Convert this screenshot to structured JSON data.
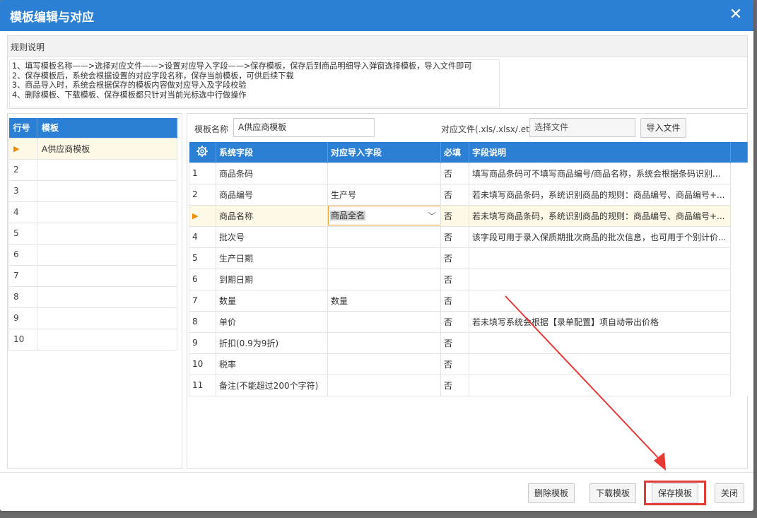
{
  "dialog": {
    "title": "模板编辑与对应",
    "close_glyph": "✕"
  },
  "rules": {
    "header": "规则说明",
    "lines": [
      "1、填写模板名称——>选择对应文件——>设置对应导入字段——>保存模板，保存后到商品明细导入弹窗选择模板，导入文件即可",
      "2、保存模板后，系统会根据设置的对应字段名称，保存当前模板，可供后续下载",
      "3、商品导入时，系统会根据保存的模板内容做对应导入及字段校验",
      "4、删除模板、下载模板、保存模板都只针对当前光标选中行做操作"
    ]
  },
  "templates": {
    "headers": [
      "行号",
      "模板"
    ],
    "rows": [
      {
        "num": "",
        "name": "A供应商模板",
        "selected": true
      },
      {
        "num": "2",
        "name": ""
      },
      {
        "num": "3",
        "name": ""
      },
      {
        "num": "4",
        "name": ""
      },
      {
        "num": "5",
        "name": ""
      },
      {
        "num": "6",
        "name": ""
      },
      {
        "num": "7",
        "name": ""
      },
      {
        "num": "8",
        "name": ""
      },
      {
        "num": "9",
        "name": ""
      },
      {
        "num": "10",
        "name": ""
      }
    ]
  },
  "form": {
    "name_label": "模板名称",
    "name_value": "A供应商模板",
    "file_label": "对应文件(.xls/.xlsx/.et)",
    "file_placeholder": "选择文件",
    "import_button": "导入文件"
  },
  "fields": {
    "headers": [
      "系统字段",
      "对应导入字段",
      "必填",
      "字段说明"
    ],
    "rows": [
      {
        "num": "1",
        "field": "商品条码",
        "mapped": "",
        "required": "否",
        "desc": "填写商品条码可不填写商品编号/商品名称，系统会根据条码识别..."
      },
      {
        "num": "2",
        "field": "商品编号",
        "mapped": "生产号",
        "required": "否",
        "desc": "若未填写商品条码，系统识别商品的规则：商品编号、商品编号+..."
      },
      {
        "num": "",
        "field": "商品名称",
        "mapped": "商品全名",
        "required": "否",
        "desc": "若未填写商品条码，系统识别商品的规则：商品编号、商品编号+...",
        "selected": true
      },
      {
        "num": "4",
        "field": "批次号",
        "mapped": "",
        "required": "否",
        "desc": "该字段可用于录入保质期批次商品的批次信息，也可用于个别计价..."
      },
      {
        "num": "5",
        "field": "生产日期",
        "mapped": "",
        "required": "否",
        "desc": ""
      },
      {
        "num": "6",
        "field": "到期日期",
        "mapped": "",
        "required": "否",
        "desc": ""
      },
      {
        "num": "7",
        "field": "数量",
        "mapped": "数量",
        "required": "否",
        "desc": ""
      },
      {
        "num": "8",
        "field": "单价",
        "mapped": "",
        "required": "否",
        "desc": "若未填写系统会根据【录单配置】项自动带出价格"
      },
      {
        "num": "9",
        "field": "折扣(0.9为9折)",
        "mapped": "",
        "required": "否",
        "desc": ""
      },
      {
        "num": "10",
        "field": "税率",
        "mapped": "",
        "required": "否",
        "desc": ""
      },
      {
        "num": "11",
        "field": "备注(不能超过200个字符)",
        "mapped": "",
        "required": "否",
        "desc": ""
      }
    ]
  },
  "footer": {
    "delete": "删除模板",
    "download": "下载模板",
    "save": "保存模板",
    "close": "关闭"
  },
  "icons": {
    "row_pointer": "▶",
    "settings": "gear-icon",
    "dropdown": "chevron-down-icon"
  },
  "colors": {
    "primary": "#2b7fd4",
    "selected_row": "#fdf9e6",
    "annotation": "#e53935"
  }
}
